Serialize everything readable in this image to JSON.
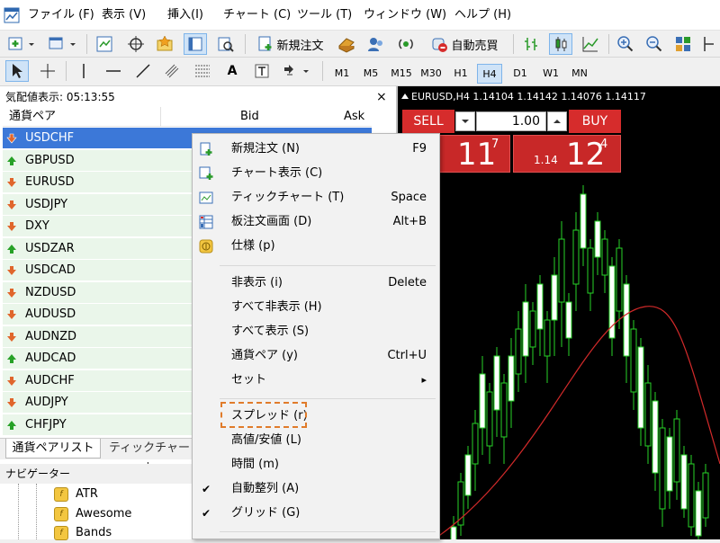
{
  "menubar": {
    "items": [
      "ファイル (F)",
      "表示 (V)",
      "挿入(I)",
      "チャート (C)",
      "ツール (T)",
      "ウィンドウ (W)",
      "ヘルプ (H)"
    ]
  },
  "toolbar1": {
    "new_order_label": "新規注文",
    "auto_trading_label": "自動売買"
  },
  "toolbar2": {
    "text_tool_label": "A",
    "timeframes": [
      "M1",
      "M5",
      "M15",
      "M30",
      "H1",
      "H4",
      "D1",
      "W1",
      "MN"
    ],
    "active_timeframe": "H4"
  },
  "market_watch": {
    "title": "気配値表示: 05:13:55",
    "close_glyph": "×",
    "columns": {
      "symbol": "通貨ペア",
      "bid": "Bid",
      "ask": "Ask"
    },
    "rows": [
      {
        "symbol": "USDCHF",
        "dir": "down"
      },
      {
        "symbol": "GBPUSD",
        "dir": "up"
      },
      {
        "symbol": "EURUSD",
        "dir": "down"
      },
      {
        "symbol": "USDJPY",
        "dir": "down"
      },
      {
        "symbol": "DXY",
        "dir": "down"
      },
      {
        "symbol": "USDZAR",
        "dir": "up"
      },
      {
        "symbol": "USDCAD",
        "dir": "down"
      },
      {
        "symbol": "NZDUSD",
        "dir": "down"
      },
      {
        "symbol": "AUDUSD",
        "dir": "down"
      },
      {
        "symbol": "AUDNZD",
        "dir": "down"
      },
      {
        "symbol": "AUDCAD",
        "dir": "up"
      },
      {
        "symbol": "AUDCHF",
        "dir": "down"
      },
      {
        "symbol": "AUDJPY",
        "dir": "down"
      },
      {
        "symbol": "CHFJPY",
        "dir": "up"
      }
    ],
    "tabs": [
      "通貨ペアリスト",
      "ティックチャート"
    ],
    "active_tab": 0
  },
  "navigator": {
    "title": "ナビゲーター",
    "items": [
      "ATR",
      "Awesome",
      "Bands"
    ]
  },
  "chart": {
    "title": "EURUSD,H4  1.14104 1.14142 1.14076 1.14117",
    "sell_label": "SELL",
    "buy_label": "BUY",
    "lot_value": "1.00",
    "sell_price_big": "11",
    "sell_price_sup": "7",
    "buy_price_small": "1.14",
    "buy_price_big": "12",
    "buy_price_sup": "4"
  },
  "context_menu": {
    "items": [
      {
        "label": "新規注文 (N)",
        "shortcut": "F9",
        "icon": "new-order-icon"
      },
      {
        "label": "チャート表示 (C)",
        "shortcut": "",
        "icon": "chart-window-icon"
      },
      {
        "label": "ティックチャート (T)",
        "shortcut": "Space",
        "icon": "tick-chart-icon"
      },
      {
        "label": "板注文画面 (D)",
        "shortcut": "Alt+B",
        "icon": "depth-of-market-icon"
      },
      {
        "label": "仕様 (p)",
        "shortcut": "",
        "icon": "specification-icon"
      },
      {
        "label": "非表示 (i)",
        "shortcut": "Delete",
        "icon": ""
      },
      {
        "label": "すべて非表示 (H)",
        "shortcut": "",
        "icon": ""
      },
      {
        "label": "すべて表示 (S)",
        "shortcut": "",
        "icon": ""
      },
      {
        "label": "通貨ペア (y)",
        "shortcut": "Ctrl+U",
        "icon": ""
      },
      {
        "label": "セット",
        "shortcut": "",
        "icon": "submenu"
      },
      {
        "label": "スプレッド (r)",
        "shortcut": "",
        "icon": ""
      },
      {
        "label": "高値/安値 (L)",
        "shortcut": "",
        "icon": ""
      },
      {
        "label": "時間 (m)",
        "shortcut": "",
        "icon": ""
      },
      {
        "label": "自動整列 (A)",
        "shortcut": "",
        "icon": "check"
      },
      {
        "label": "グリッド (G)",
        "shortcut": "",
        "icon": "check"
      }
    ],
    "submenu_glyph": "▸",
    "check_glyph": "✔"
  }
}
